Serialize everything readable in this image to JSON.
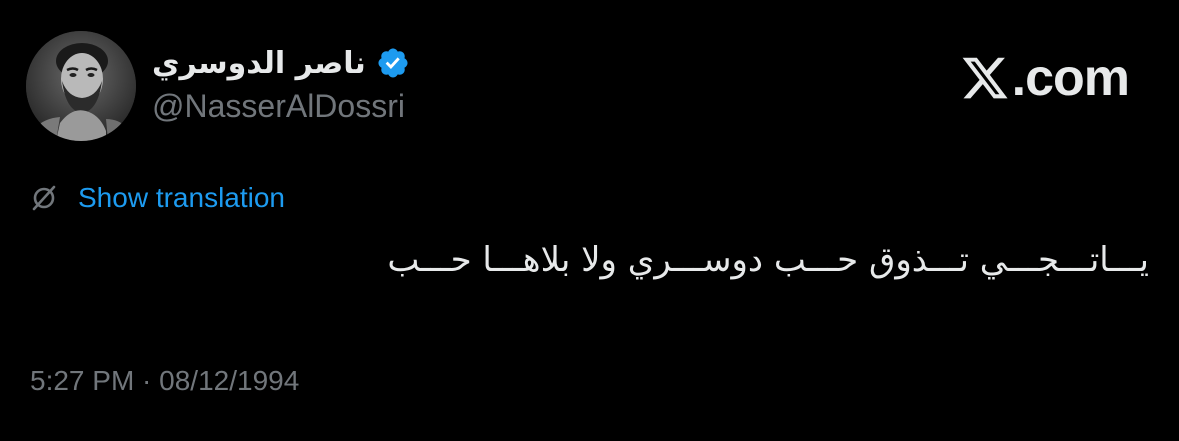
{
  "author": {
    "display_name": "ناصر الدوسري",
    "handle": "@NasserAlDossri",
    "verified": true,
    "verified_color": "#1d9bf0",
    "avatar": "profile-photo-grayscale"
  },
  "brand": {
    "text": ".com",
    "logo": "x-logo-icon"
  },
  "translation": {
    "label": "Show translation",
    "icon": "globe-slash-icon",
    "link_color": "#1d9bf0"
  },
  "tweet": {
    "text": "يـــاتـــجـــي تـــذوق حـــب دوســـري ولا بلاهـــا حـــب"
  },
  "timestamp": {
    "text": "5:27 PM · 08/12/1994"
  },
  "colors": {
    "background": "#000000",
    "primary_text": "#e7e9ea",
    "secondary_text": "#71767b"
  }
}
